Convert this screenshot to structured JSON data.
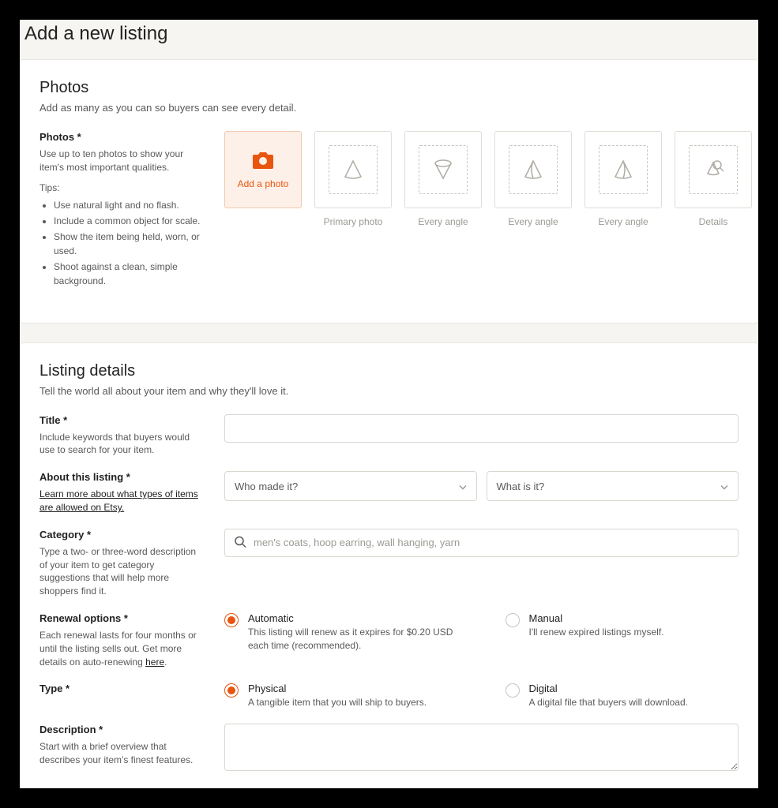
{
  "page": {
    "title": "Add a new listing"
  },
  "photos": {
    "title": "Photos",
    "subtitle": "Add as many as you can so buyers can see every detail.",
    "field_label": "Photos *",
    "field_help": "Use up to ten photos to show your item's most important qualities.",
    "tips_label": "Tips:",
    "tips": [
      "Use natural light and no flash.",
      "Include a common object for scale.",
      "Show the item being held, worn, or used.",
      "Shoot against a clean, simple background."
    ],
    "add_label": "Add a photo",
    "slots": [
      "Primary photo",
      "Every angle",
      "Every angle",
      "Every angle",
      "Details"
    ]
  },
  "details": {
    "title": "Listing details",
    "subtitle": "Tell the world all about your item and why they'll love it.",
    "title_field": {
      "label": "Title *",
      "help": "Include keywords that buyers would use to search for your item."
    },
    "about": {
      "label": "About this listing *",
      "link": "Learn more about what types of items are allowed on Etsy.",
      "who_made": "Who made it?",
      "what_is": "What is it?"
    },
    "category": {
      "label": "Category *",
      "help": "Type a two- or three-word description of your item to get category suggestions that will help more shoppers find it.",
      "placeholder": "men's coats, hoop earring, wall hanging, yarn"
    },
    "renewal": {
      "label": "Renewal options *",
      "help_a": "Each renewal lasts for four months or until the listing sells out. Get more details on auto-renewing ",
      "help_link": "here",
      "help_b": ".",
      "auto_title": "Automatic",
      "auto_desc": "This listing will renew as it expires for $0.20 USD each time (recommended).",
      "manual_title": "Manual",
      "manual_desc": "I'll renew expired listings myself."
    },
    "type": {
      "label": "Type *",
      "physical_title": "Physical",
      "physical_desc": "A tangible item that you will ship to buyers.",
      "digital_title": "Digital",
      "digital_desc": "A digital file that buyers will download."
    },
    "description": {
      "label": "Description *",
      "help": "Start with a brief overview that describes your item's finest features."
    }
  }
}
